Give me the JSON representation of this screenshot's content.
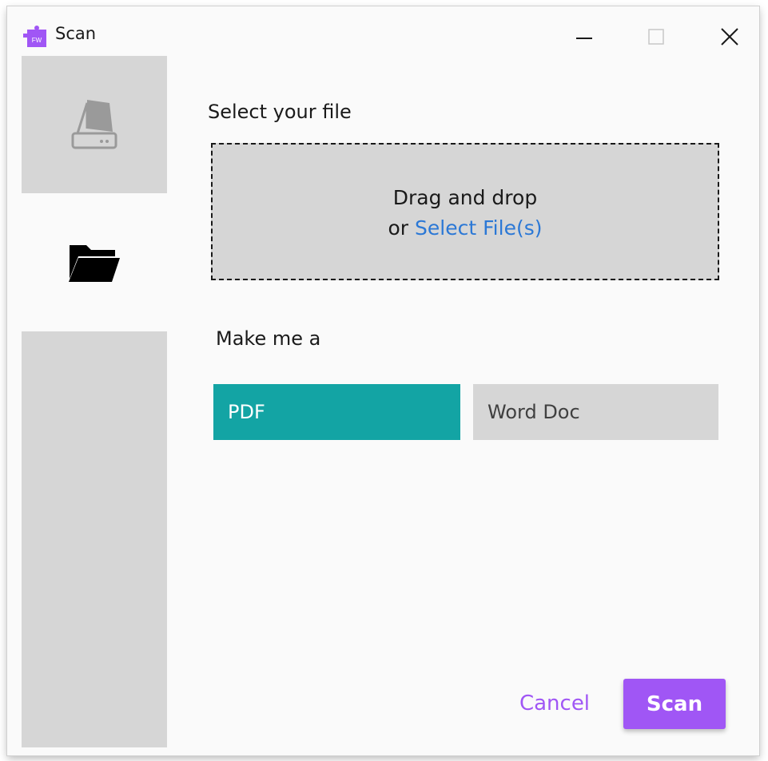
{
  "window": {
    "title": "Scan",
    "app_icon": "puzzle-icon",
    "controls": {
      "minimize": "minimize-icon",
      "maximize": "maximize-icon",
      "close": "close-icon"
    }
  },
  "sidebar": {
    "items": [
      {
        "icon": "scanner-icon",
        "selected": false
      },
      {
        "icon": "folder-icon",
        "selected": true
      }
    ]
  },
  "main": {
    "select_label": "Select your file",
    "dropzone": {
      "line1": "Drag and drop",
      "line2_prefix": "or ",
      "link": "Select File(s)"
    },
    "make_label": "Make me a",
    "options": [
      {
        "label": "PDF",
        "selected": true
      },
      {
        "label": "Word Doc",
        "selected": false
      }
    ]
  },
  "actions": {
    "cancel": "Cancel",
    "scan": "Scan"
  },
  "colors": {
    "accent_purple": "#a056f5",
    "selected_teal": "#13a4a4",
    "link_blue": "#2b78d6",
    "panel_gray": "#d6d6d6",
    "background": "#fafafa"
  }
}
